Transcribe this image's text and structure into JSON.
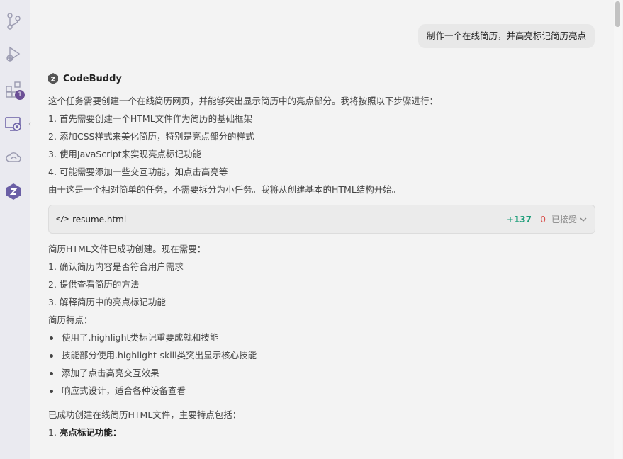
{
  "activity_bar": {
    "extensions_badge": "1"
  },
  "chat": {
    "user_message": "制作一个在线简历，并高亮标记简历亮点",
    "assistant_name": "CodeBuddy",
    "intro_lines": [
      "这个任务需要创建一个在线简历网页，并能够突出显示简历中的亮点部分。我将按照以下步骤进行：",
      "1. 首先需要创建一个HTML文件作为简历的基础框架",
      "2. 添加CSS样式来美化简历，特别是亮点部分的样式",
      "3. 使用JavaScript来实现亮点标记功能",
      "4. 可能需要添加一些交互功能，如点击高亮等",
      "由于这是一个相对简单的任务，不需要拆分为小任务。我将从创建基本的HTML结构开始。"
    ],
    "file_card": {
      "icon": "</>",
      "filename": "resume.html",
      "additions": "+137",
      "deletions": "-0",
      "status": "已接受"
    },
    "after_lines": [
      "简历HTML文件已成功创建。现在需要：",
      "1. 确认简历内容是否符合用户需求",
      "2. 提供查看简历的方法",
      "3. 解释简历中的亮点标记功能",
      "简历特点："
    ],
    "feature_bullets": [
      "使用了.highlight类标记重要成就和技能",
      "技能部分使用.highlight-skill类突出显示核心技能",
      "添加了点击高亮交互效果",
      "响应式设计，适合各种设备查看"
    ],
    "summary_line": "已成功创建在线简历HTML文件，主要特点包括：",
    "summary_item_prefix": "1. ",
    "summary_item_bold": "亮点标记功能："
  }
}
